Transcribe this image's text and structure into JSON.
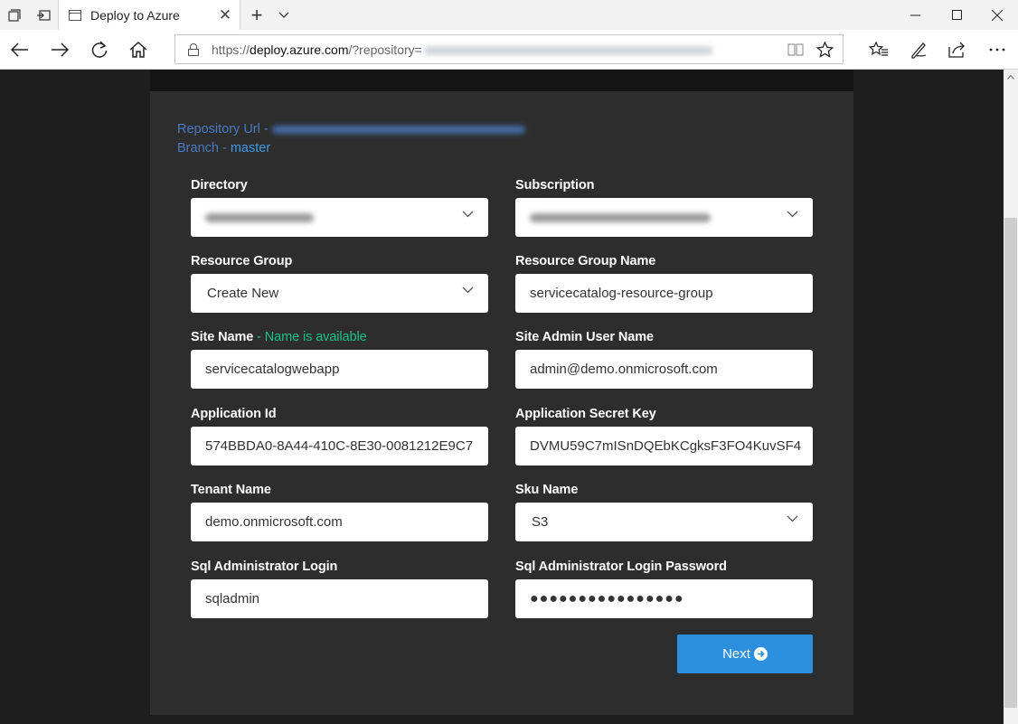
{
  "browser": {
    "tab_title": "Deploy to Azure",
    "url_scheme": "https://",
    "url_host": "deploy.azure.com",
    "url_path": "/?repository="
  },
  "icons": [
    "tab-actions-icon",
    "set-tabs-aside-icon",
    "page-icon",
    "close-icon",
    "new-tab-icon",
    "tab-list-icon",
    "minimize-icon",
    "maximize-icon",
    "window-close-icon",
    "back-icon",
    "forward-icon",
    "refresh-icon",
    "home-icon",
    "lock-icon",
    "reading-view-icon",
    "favorite-star-icon",
    "favorites-list-icon",
    "pen-icon",
    "share-icon",
    "more-icon",
    "chevron-down-icon",
    "arrow-circle-right-icon"
  ],
  "repo": {
    "repository_label": "Repository Url - ",
    "branch_label": "Branch - ",
    "branch_value": "master"
  },
  "form": {
    "directory": {
      "label": "Directory"
    },
    "subscription": {
      "label": "Subscription"
    },
    "resource_group": {
      "label": "Resource Group",
      "value": "Create New"
    },
    "resource_group_name": {
      "label": "Resource Group Name",
      "value": "servicecatalog-resource-group"
    },
    "site_name": {
      "label": "Site Name",
      "availability": " - Name is available",
      "value": "servicecatalogwebapp"
    },
    "site_admin_user_name": {
      "label": "Site Admin User Name",
      "value": "admin@demo.onmicrosoft.com"
    },
    "application_id": {
      "label": "Application Id",
      "value": "574BBDA0-8A44-410C-8E30-0081212E9C7"
    },
    "application_secret_key": {
      "label": "Application Secret Key",
      "value": "DVMU59C7mISnDQEbKCgksF3FO4KuvSF4"
    },
    "tenant_name": {
      "label": "Tenant Name",
      "value": "demo.onmicrosoft.com"
    },
    "sku_name": {
      "label": "Sku Name",
      "value": "S3"
    },
    "sql_admin_login": {
      "label": "Sql Administrator Login",
      "value": "sqladmin"
    },
    "sql_admin_password": {
      "label": "Sql Administrator Login Password",
      "value": "●●●●●●●●●●●●●●●●"
    }
  },
  "next_button": {
    "label": "Next"
  },
  "colors": {
    "accent": "#2b8fde",
    "available": "#19c28a",
    "link": "#4a7ac4",
    "card": "#2d2d2d"
  }
}
